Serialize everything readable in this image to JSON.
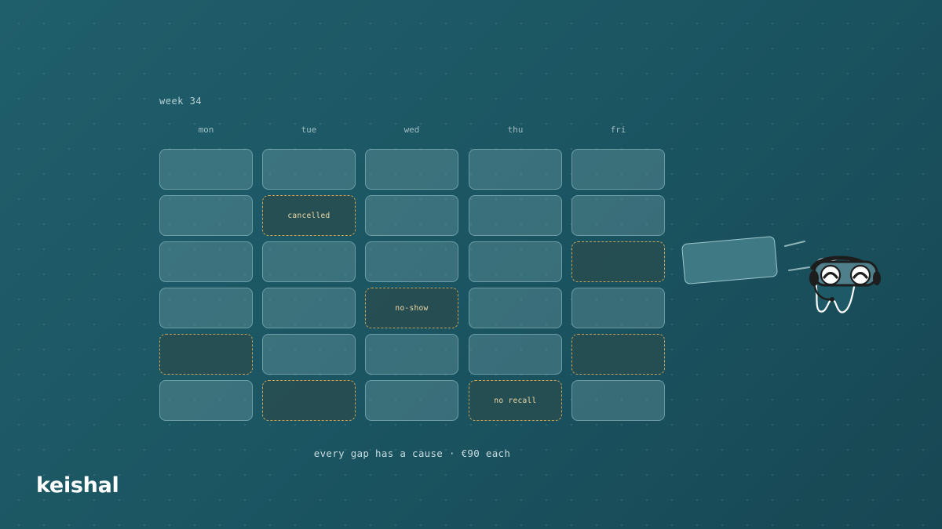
{
  "week_label": "week 34",
  "days": [
    "mon",
    "tue",
    "wed",
    "thu",
    "fri"
  ],
  "slot_labels": {
    "cancelled": "cancelled",
    "no_show": "no-show",
    "no_recall": "no recall"
  },
  "caption": "every gap has a cause · €90 each",
  "brand": "keishal",
  "colors": {
    "gap_border": "#c7a45c",
    "gap_label": "#f0d8a4",
    "background": "#1b5562"
  },
  "icons": [
    "tooth-mascot-icon",
    "headset-icon"
  ]
}
